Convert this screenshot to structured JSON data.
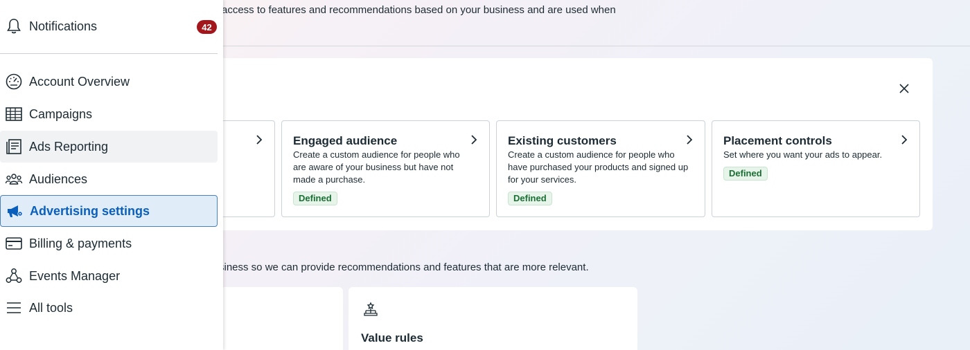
{
  "main": {
    "intro_text": "access to features and recommendations based on your business and are used when",
    "sub_text": "siness so we can provide recommendations and features that are more relevant.",
    "cards": [
      {
        "title": "Engaged audience",
        "description": "Create a custom audience for people who are aware of your business but have not made a purchase.",
        "badge": "Defined"
      },
      {
        "title": "Existing customers",
        "description": "Create a custom audience for people who have purchased your products and signed up for your services.",
        "badge": "Defined"
      },
      {
        "title": "Placement controls",
        "description": "Set where you want your ads to appear.",
        "badge": "Defined"
      }
    ],
    "lower_cards": [
      {
        "title": ""
      },
      {
        "title": "Value rules",
        "icon": "value-rules-icon"
      }
    ]
  },
  "sidebar": {
    "notifications": {
      "label": "Notifications",
      "count": "42",
      "icon": "bell-icon"
    },
    "items": [
      {
        "label": "Account Overview",
        "icon": "gauge-icon"
      },
      {
        "label": "Campaigns",
        "icon": "table-icon"
      },
      {
        "label": "Ads Reporting",
        "icon": "report-icon"
      },
      {
        "label": "Audiences",
        "icon": "people-icon"
      },
      {
        "label": "Advertising settings",
        "icon": "megaphone-icon"
      },
      {
        "label": "Billing & payments",
        "icon": "card-icon"
      },
      {
        "label": "Events Manager",
        "icon": "events-icon"
      },
      {
        "label": "All tools",
        "icon": "menu-icon"
      }
    ]
  },
  "colors": {
    "active_text": "#0a5fbd",
    "badge_text": "#1b6e34",
    "notification_badge": "#a3161c"
  }
}
